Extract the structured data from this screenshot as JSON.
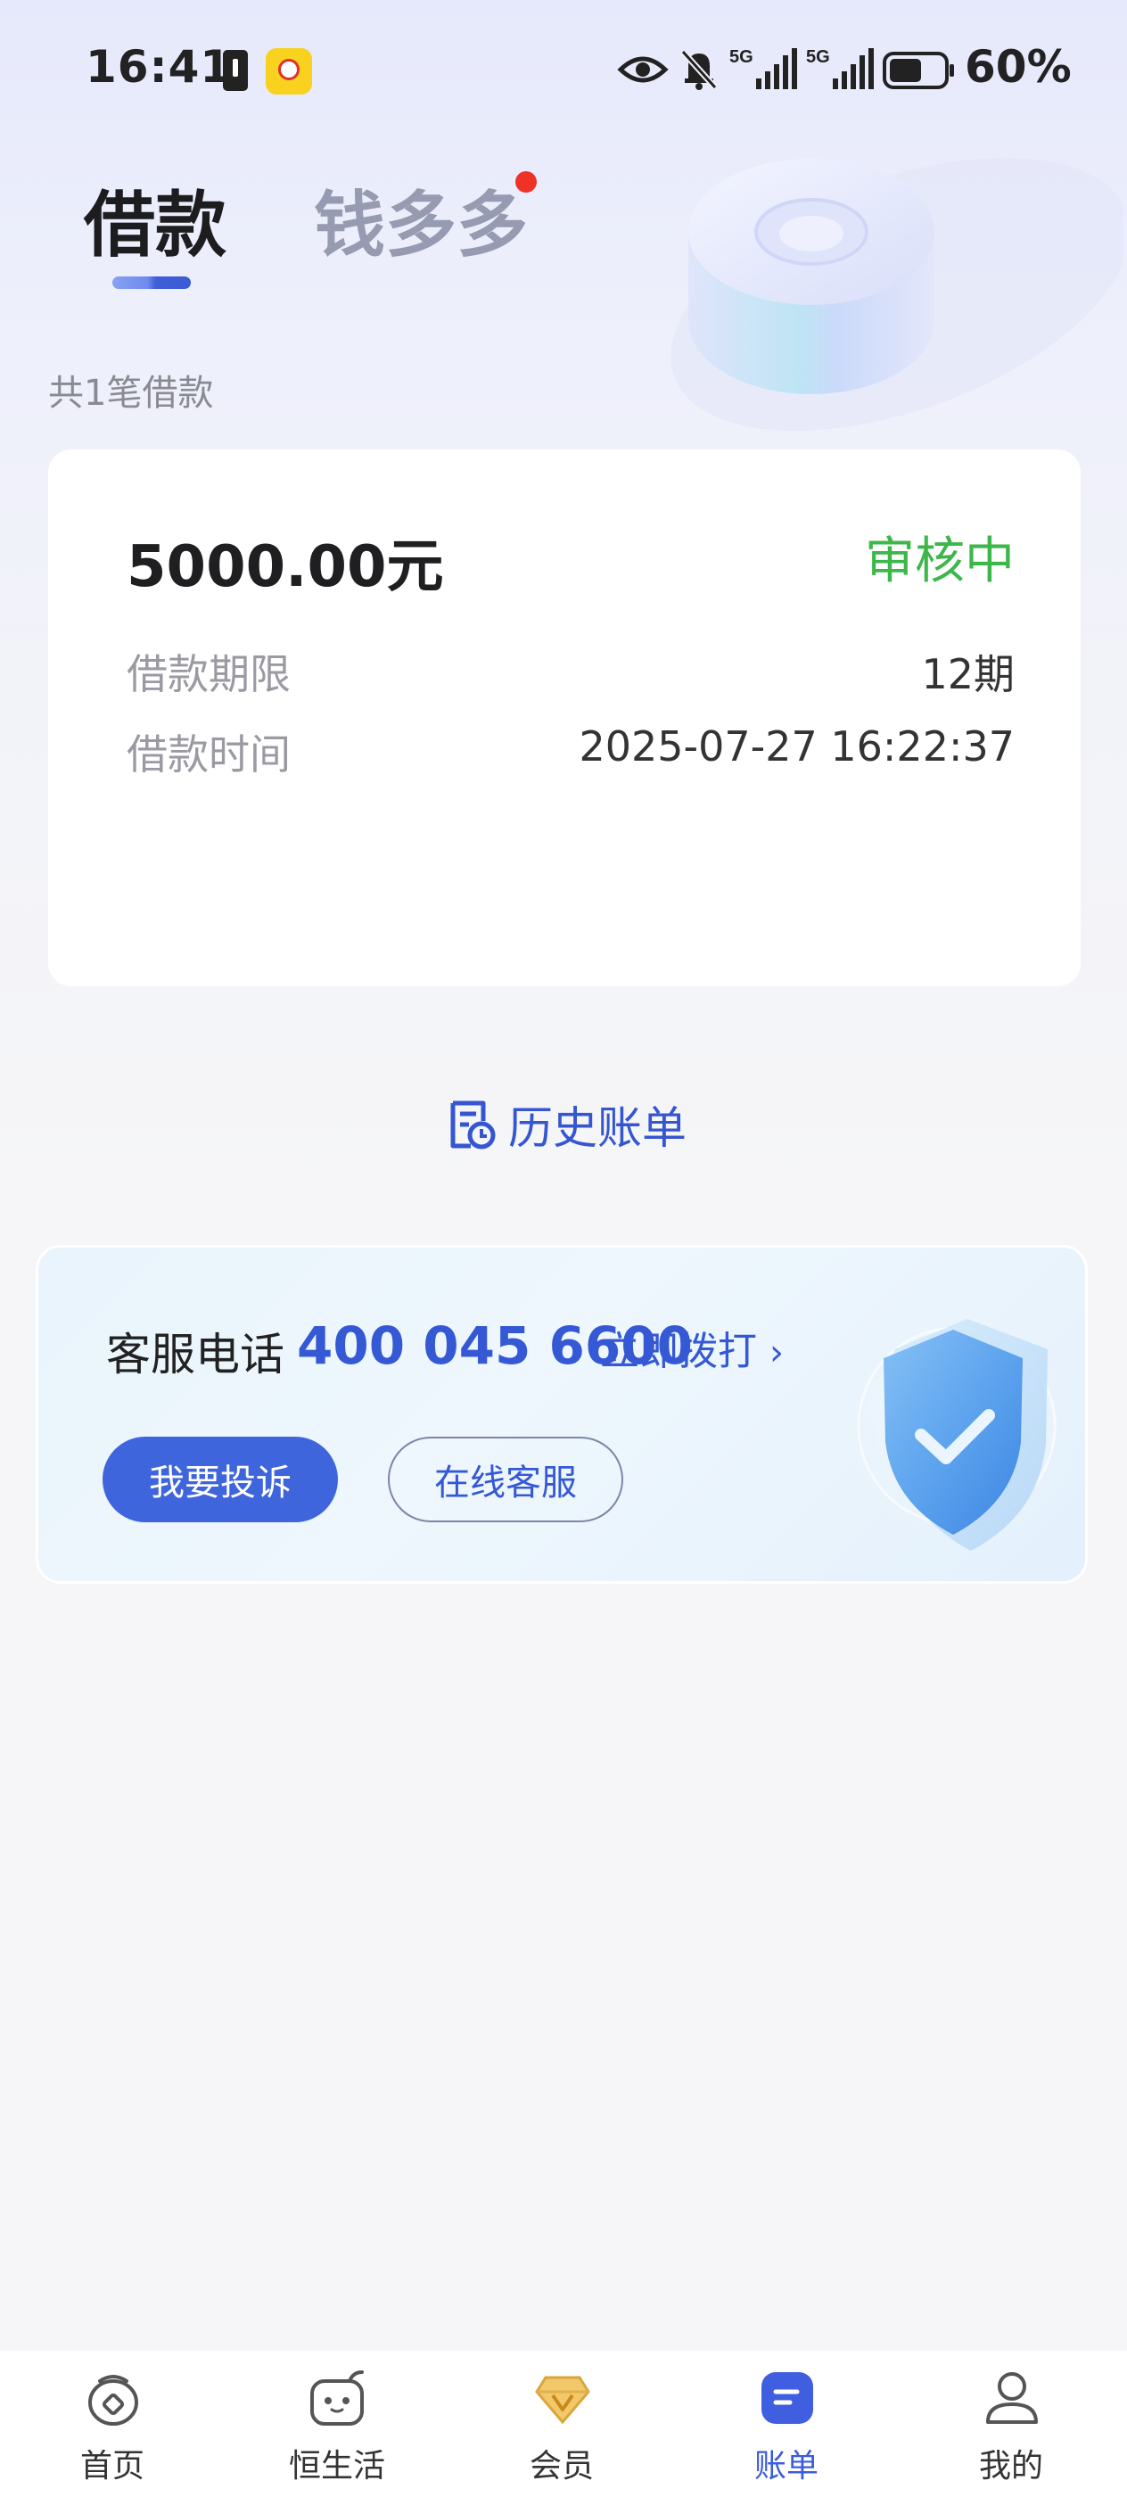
{
  "status_bar": {
    "time": "16:41",
    "network_1": "5G",
    "network_2": "5G",
    "battery": "60%",
    "battery_level": 0.6
  },
  "tabs": [
    {
      "label": "借款",
      "active": true
    },
    {
      "label": "钱多多",
      "active": false,
      "has_badge_dot": true
    }
  ],
  "loan_summary": {
    "count_label": "共1笔借款"
  },
  "loan_card": {
    "amount": "5000.00元",
    "status": "审核中",
    "status_color": "#3db64a",
    "term_label": "借款期限",
    "term_value": "12期",
    "time_label": "借款时间",
    "time_value": "2025-07-27 16:22:37"
  },
  "history": {
    "label": "历史账单",
    "icon": "bill-history-icon"
  },
  "service": {
    "label": "客服电话",
    "phone": "400 045 6600",
    "call_label": "立即拨打",
    "complain_button": "我要投诉",
    "online_button": "在线客服",
    "accent_color": "#3558d4"
  },
  "bottom_nav": [
    {
      "label": "首页",
      "icon": "home-icon",
      "active": false
    },
    {
      "label": "恒生活",
      "icon": "life-icon",
      "active": false
    },
    {
      "label": "会员",
      "icon": "vip-diamond-icon",
      "active": false
    },
    {
      "label": "账单",
      "icon": "bill-icon",
      "active": true
    },
    {
      "label": "我的",
      "icon": "profile-icon",
      "active": false
    }
  ]
}
